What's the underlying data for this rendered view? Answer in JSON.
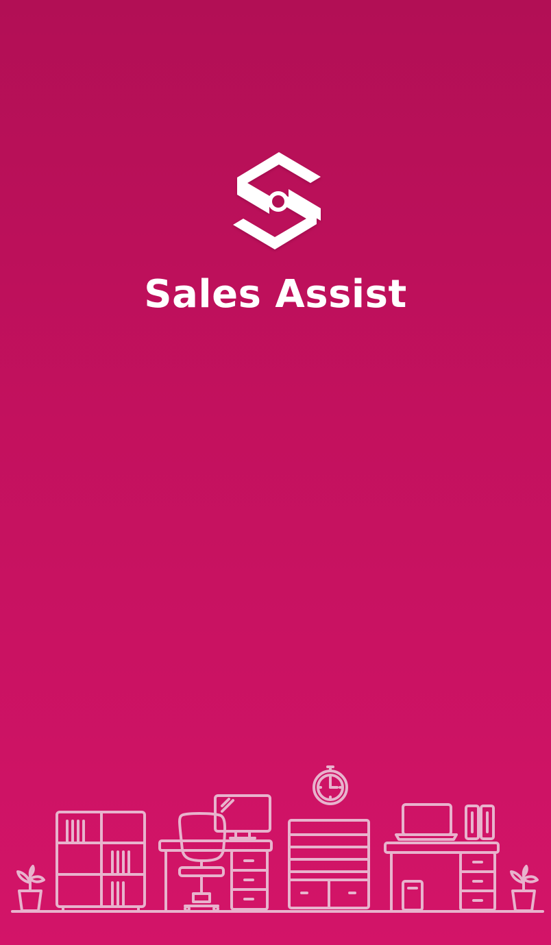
{
  "splash": {
    "app_name": "Sales Assist",
    "logo_icon": "sales-assist-s-logo-icon",
    "illustration": "office-furniture-line-illustration",
    "colors": {
      "background_top": "#b20f55",
      "background_bottom": "#d31468",
      "text": "#ffffff",
      "illustration_stroke": "#e8b3cd"
    }
  }
}
